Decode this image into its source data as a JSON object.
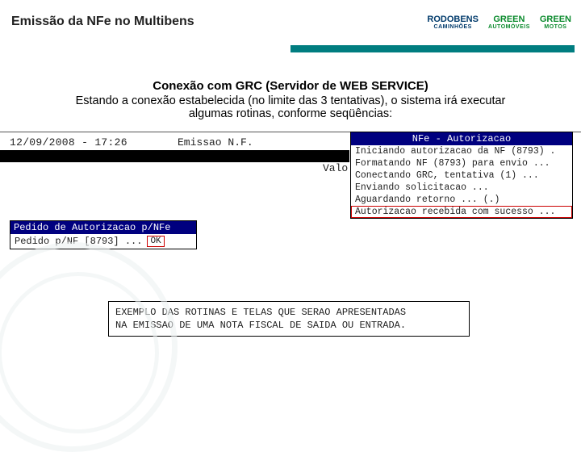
{
  "slide": {
    "title": "Emissão da NFe no Multibens",
    "logos": [
      {
        "brand": "RODOBENS",
        "sub": "CAMINHÕES"
      },
      {
        "brand": "GREEN",
        "sub": "AUTOMÓVEIS"
      },
      {
        "brand": "GREEN",
        "sub": "MOTOS"
      }
    ]
  },
  "intro": {
    "title": "Conexão com GRC (Servidor de WEB SERVICE)",
    "body": "Estando a conexão estabelecida (no limite das 3 tentativas), o sistema irá executar algumas rotinas, conforme seqüências:"
  },
  "term": {
    "timestamp": "12/09/2008 - 17:26",
    "module": "Emissao N.F.",
    "valo": "Valo"
  },
  "popup_auth": {
    "header": "NFe - Autorizacao",
    "lines": [
      "Iniciando autorizacao da NF (8793) .",
      "Formatando NF (8793) para envio ...",
      "Conectando GRC, tentativa (1) ...",
      "Enviando solicitacao ...",
      "Aguardando retorno ... (.)",
      "Autorizacao recebida com sucesso ..."
    ]
  },
  "popup_pedido": {
    "header": "Pedido de Autorizacao p/NFe",
    "line": "Pedido p/NF [8793] ...",
    "ok": "OK"
  },
  "note": {
    "l1": "EXEMPLO DAS ROTINAS E TELAS QUE SERAO APRESENTADAS",
    "l2": "NA EMISSAO DE UMA NOTA FISCAL DE SAIDA OU ENTRADA."
  }
}
